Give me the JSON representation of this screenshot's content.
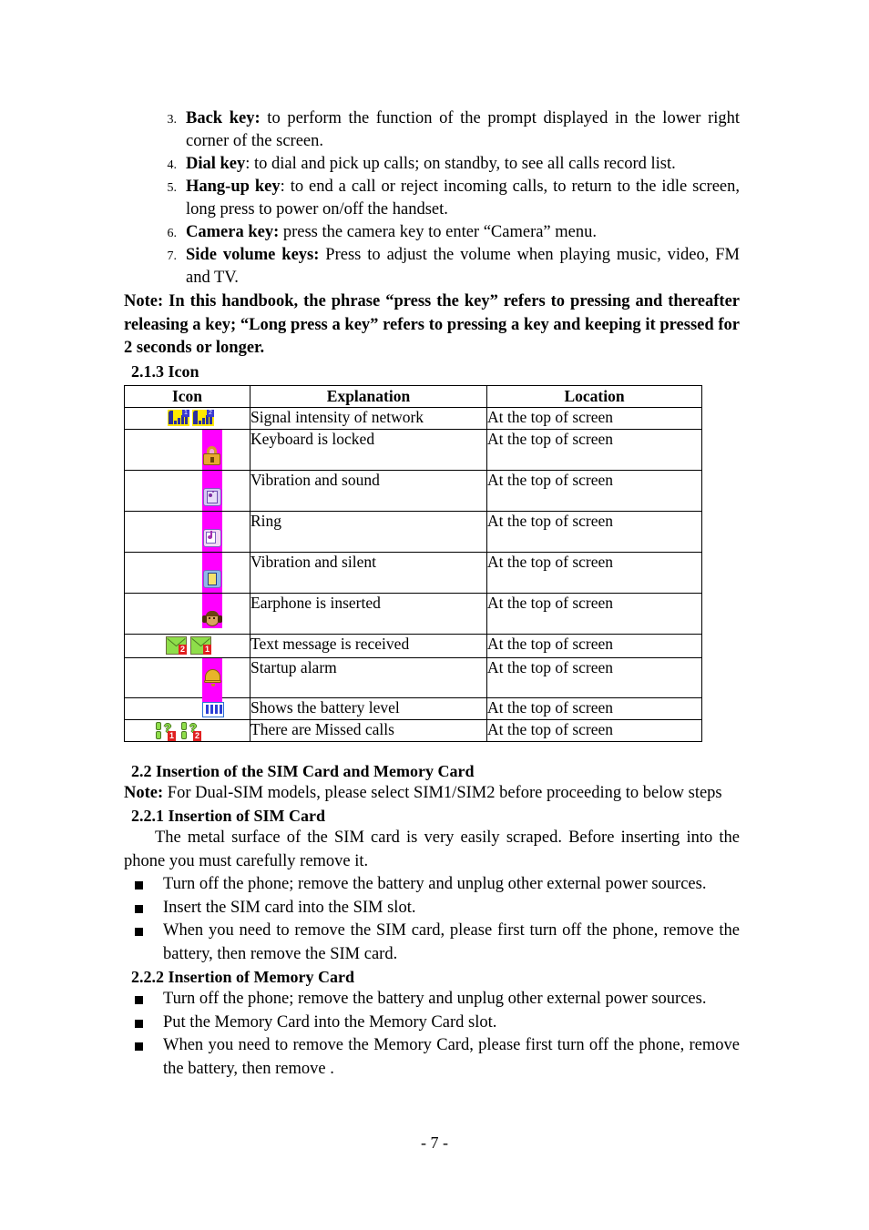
{
  "document": {
    "page_number_label": "- 7 -"
  },
  "key_list": [
    {
      "number": "3.",
      "term": "Back key:",
      "text": " to perform the function of the prompt displayed in the lower right corner of the screen."
    },
    {
      "number": "4.",
      "term": "Dial key",
      "text": ": to dial and pick up calls; on standby, to see all calls record list."
    },
    {
      "number": "5.",
      "term": "Hang-up key",
      "text": ": to end a call or reject incoming calls, to return to the idle screen, long press to power on/off the handset."
    },
    {
      "number": "6.",
      "term": "Camera key:",
      "text": " press the camera key to enter “Camera” menu."
    },
    {
      "number": "7.",
      "term": "Side volume keys:",
      "text": " Press to adjust the volume when playing music, video, FM and TV."
    }
  ],
  "note_paragraph": "Note: In this handbook, the phrase “press the key” refers to pressing and thereafter releasing a key; “Long press a key” refers to pressing a key and keeping it pressed for 2 seconds or longer.",
  "icon_section": {
    "heading": "2.1.3 Icon",
    "table": {
      "headers": [
        "Icon",
        "Explanation",
        "Location"
      ],
      "rows": [
        {
          "icon_name": "signal-strength-icon",
          "explanation": "Signal intensity of network",
          "location": "At the top of screen"
        },
        {
          "icon_name": "keypad-lock-icon",
          "explanation": "Keyboard is locked",
          "location": "At the top of screen"
        },
        {
          "icon_name": "vibration-and-sound-icon",
          "explanation": "Vibration and sound",
          "location": "At the top of screen"
        },
        {
          "icon_name": "ring-icon",
          "explanation": "Ring",
          "location": "At the top of screen"
        },
        {
          "icon_name": "vibration-and-silent-icon",
          "explanation": "Vibration and silent",
          "location": "At the top of screen"
        },
        {
          "icon_name": "earphone-icon",
          "explanation": "Earphone is inserted",
          "location": "At the top of screen"
        },
        {
          "icon_name": "text-message-icon",
          "explanation": "Text message is received",
          "location": "At the top of screen"
        },
        {
          "icon_name": "startup-alarm-bell-icon",
          "explanation": "Startup alarm",
          "location": "At the top of screen"
        },
        {
          "icon_name": "battery-level-icon",
          "explanation": "Shows the battery level",
          "location": "At the top of screen"
        },
        {
          "icon_name": "missed-calls-icon",
          "explanation": "There are Missed calls",
          "location": "At the top of screen"
        }
      ],
      "icon_badges": {
        "signal_sim1": "1",
        "signal_sim2": "2",
        "message_badge_left": "2",
        "message_badge_right": "1",
        "misscall_badge_left": "1",
        "misscall_badge_right": "2",
        "misscall_glyph": "?"
      }
    }
  },
  "sim_section": {
    "heading": "2.2 Insertion of the SIM Card and Memory Card",
    "note_label": "Note:",
    "note_text": " For Dual-SIM models, please select SIM1/SIM2 before proceeding to below steps",
    "sub1_heading": "2.2.1 Insertion of SIM Card",
    "sub1_paragraph": "The metal surface of the SIM card is very easily scraped. Before inserting into the phone you must carefully remove it.",
    "sub1_bullets": [
      "Turn off the phone; remove the battery and unplug other external power sources.",
      "Insert the SIM card into the SIM slot.",
      "When you need to remove the SIM card, please first turn off the phone, remove the battery, then remove the SIM card."
    ],
    "sub2_heading": "2.2.2 Insertion of Memory Card",
    "sub2_bullets": [
      "Turn off the phone; remove the battery and unplug other external power sources.",
      "Put the Memory Card into the Memory Card slot.",
      "When you need to remove the Memory Card, please first turn off the phone, remove the battery, then remove ."
    ]
  },
  "colors": {
    "magenta_band": "#ff00ff",
    "signal_background": "#ffe900",
    "badge_red": "#e02020",
    "envelope_green": "#8ede4a",
    "bell_gold": "#e8b42a"
  }
}
